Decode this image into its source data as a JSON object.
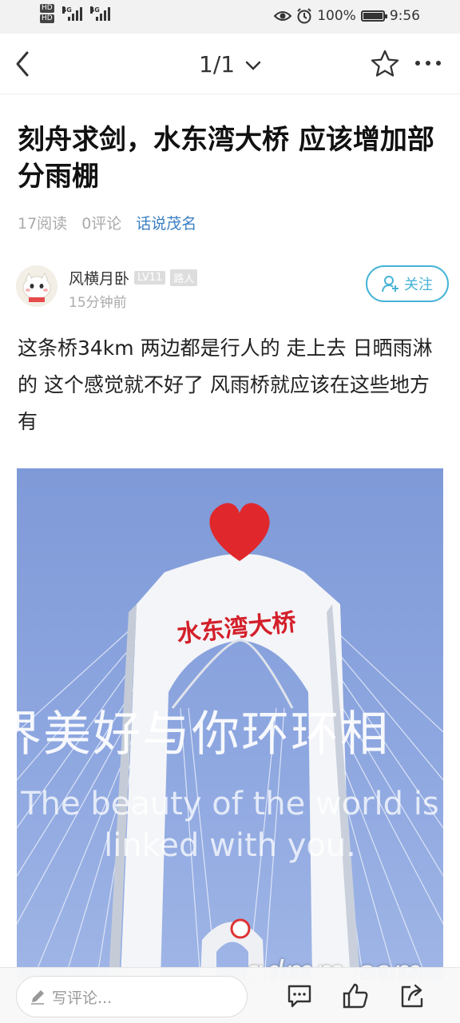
{
  "status": {
    "hd1": "HD",
    "hd2": "HD",
    "net1": "4G",
    "net2": "4G",
    "battery_percent": "100%",
    "battery_level": 1.0,
    "time": "9:56"
  },
  "nav": {
    "pager": "1/1",
    "icons": [
      "back-arrow-icon",
      "chevron-down-icon",
      "star-icon",
      "more-icon"
    ]
  },
  "article": {
    "title": "刻舟求剑，水东湾大桥 应该增加部分雨棚",
    "reads": "17阅读",
    "comments": "0评论",
    "topic": "话说茂名",
    "author": {
      "name": "风横月卧",
      "level": "LV11",
      "role": "路人",
      "time": "15分钟前",
      "follow_label": "关注"
    },
    "body": "这条桥34km 两边都是行人的 走上去 日晒雨淋的 这个感觉就不好了 风雨桥就应该在这些地方有",
    "image": {
      "arch_text": "水东湾大桥",
      "overlay_cn": "界美好与你环环相",
      "overlay_en": "The beauty of the world is linked with you."
    }
  },
  "watermark": "gdmm.com",
  "bottom_bar": {
    "comment_placeholder": "写评论...",
    "icons": [
      "pencil-icon",
      "comment-icon",
      "like-icon",
      "share-icon"
    ]
  },
  "colors": {
    "accent": "#46b3d6",
    "topic": "#3a7fc4",
    "heart": "#e0282c",
    "sky": "#8ea7e0"
  }
}
